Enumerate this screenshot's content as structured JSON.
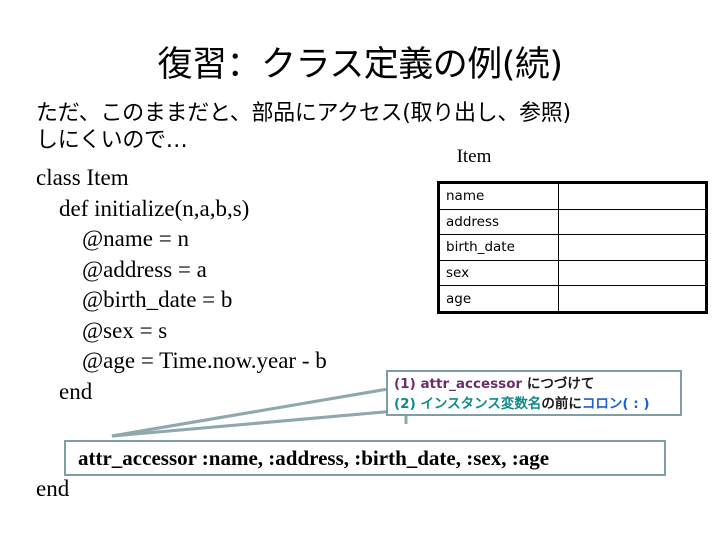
{
  "slide": {
    "title": "復習：クラス定義の例(続)",
    "intro_lines": [
      "ただ、このままだと、部品にアクセス(取り出し、参照)",
      "しにくいので…"
    ],
    "code_lines": [
      "class Item",
      "    def initialize(n,a,b,s)",
      "        @name = n",
      "        @address = a",
      "        @birth_date = b",
      "        @sex = s",
      "        @age = Time.now.year - b",
      "    end"
    ],
    "final_end": "end"
  },
  "item_diagram": {
    "caption": "Item",
    "rows": [
      {
        "key": "name",
        "value": ""
      },
      {
        "key": "address",
        "value": ""
      },
      {
        "key": "birth_date",
        "value": ""
      },
      {
        "key": "sex",
        "value": ""
      },
      {
        "key": "age",
        "value": ""
      }
    ]
  },
  "callout": {
    "line1": {
      "marker": "(1)",
      "code": "attr_accessor",
      "tail": "につづけて"
    },
    "line2": {
      "marker": "(2)",
      "term": "インスタンス変数名",
      "middle": "の前に",
      "highlight": "コロン( : )"
    }
  },
  "attr_box": {
    "text": "attr_accessor  :name, :address, :birth_date, :sex, :age"
  },
  "colors": {
    "purple": "#6b2d6b",
    "teal": "#0f8a8a",
    "blue": "#1f5fd0",
    "callout_border": "#7f9ea5",
    "table_border": "#000000"
  }
}
